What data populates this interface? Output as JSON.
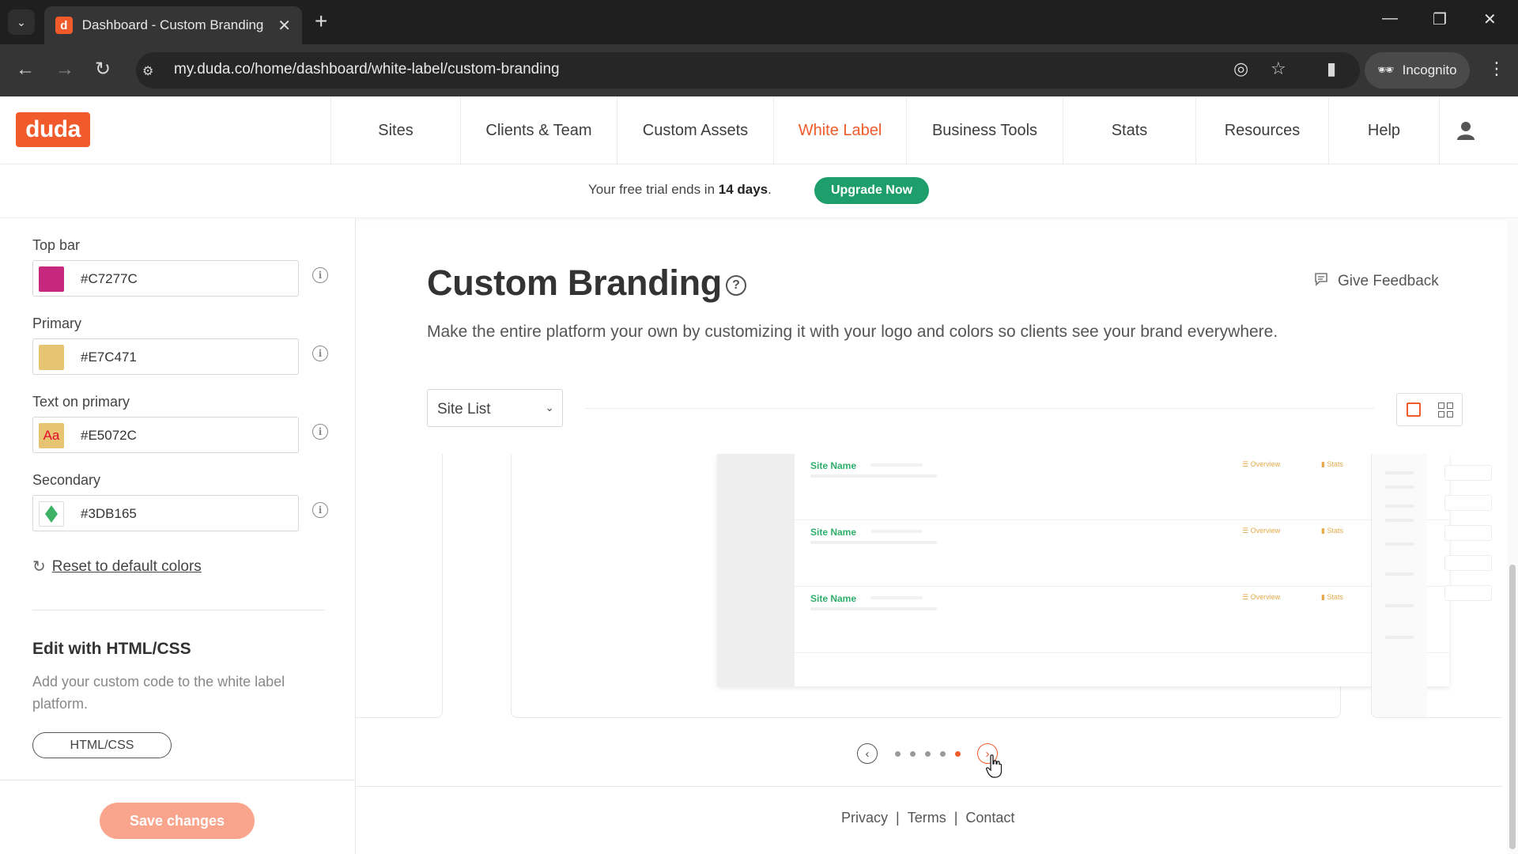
{
  "browser": {
    "tab_title": "Dashboard - Custom Branding |",
    "favicon_letter": "d",
    "url": "my.duda.co/home/dashboard/white-label/custom-branding",
    "incognito_label": "Incognito"
  },
  "header": {
    "logo_text": "duda",
    "nav": [
      {
        "label": "Sites",
        "active": false
      },
      {
        "label": "Clients & Team",
        "active": false
      },
      {
        "label": "Custom Assets",
        "active": false
      },
      {
        "label": "White Label",
        "active": true
      },
      {
        "label": "Business Tools",
        "active": false
      },
      {
        "label": "Stats",
        "active": false
      },
      {
        "label": "Resources",
        "active": false
      },
      {
        "label": "Help",
        "active": false
      }
    ]
  },
  "trial": {
    "text_before": "Your free trial ends in ",
    "days": "14 days",
    "text_after": ".",
    "upgrade_label": "Upgrade Now"
  },
  "colors": {
    "top_bar": {
      "label": "Top bar",
      "value": "#C7277C",
      "swatch": "#C7277C"
    },
    "primary": {
      "label": "Primary",
      "value": "#E7C471",
      "swatch": "#E7C471"
    },
    "text_on_primary": {
      "label": "Text on primary",
      "value": "#E5072C",
      "swatch": "#E7C471",
      "swatch_text": "Aa",
      "swatch_text_color": "#E5072C"
    },
    "secondary": {
      "label": "Secondary",
      "value": "#3DB165",
      "swatch": "#3DB165"
    },
    "reset_label": "Reset to default colors"
  },
  "edit": {
    "title": "Edit with HTML/CSS",
    "description": "Add your custom code to the white label platform.",
    "button_label": "HTML/CSS"
  },
  "save_label": "Save changes",
  "main": {
    "title": "Custom Branding",
    "feedback_label": "Give Feedback",
    "subtitle": "Make the entire platform your own by customizing it with your logo and colors so clients see your brand everywhere.",
    "view_select": "Site List",
    "preview_rows": [
      {
        "name": "Site Name",
        "overview": "Overview",
        "stats": "Stats"
      },
      {
        "name": "Site Name",
        "overview": "Overview",
        "stats": "Stats"
      },
      {
        "name": "Site Name",
        "overview": "Overview",
        "stats": "Stats"
      }
    ],
    "pager": {
      "count": 5,
      "active_index": 4
    }
  },
  "footer": {
    "privacy": "Privacy",
    "terms": "Terms",
    "contact": "Contact",
    "separator": "|"
  },
  "accent_colors": {
    "brand": "#F15A2B",
    "upgrade": "#1E9E6A",
    "save_disabled": "#F9A58E"
  }
}
